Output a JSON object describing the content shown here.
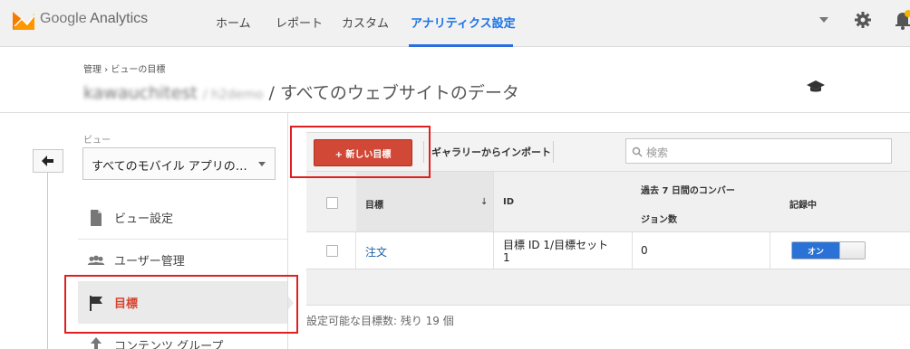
{
  "header": {
    "brand_google": "Google",
    "brand_product": "Analytics",
    "nav": [
      {
        "label": "ホーム",
        "active": false
      },
      {
        "label": "レポート",
        "active": false
      },
      {
        "label": "カスタム",
        "active": false
      },
      {
        "label": "アナリティクス設定",
        "active": true
      }
    ],
    "icons": [
      "analytics-logo-icon",
      "chevron-down-icon",
      "gear-icon",
      "bell-icon"
    ]
  },
  "breadcrumb": {
    "text": "管理 › ビューの目標"
  },
  "page_title": {
    "account_blurred": "kawauchitest",
    "property_blurred": "/ h2demo",
    "view": "/ すべてのウェブサイトのデータ"
  },
  "sidebar": {
    "view_label": "ビュー",
    "view_selected": "すべてのモバイル アプリの…",
    "items": [
      {
        "label": "ビュー設定",
        "icon": "document-icon",
        "active": false
      },
      {
        "label": "ユーザー管理",
        "icon": "users-icon",
        "active": false
      },
      {
        "label": "目標",
        "icon": "flag-icon",
        "active": true
      },
      {
        "label": "コンテンツ グループ",
        "icon": "content-group-icon",
        "active": false
      }
    ]
  },
  "toolbar": {
    "new_goal_label": "+ 新しい目標",
    "gallery_import_label": "ギャラリーからインポート",
    "search_placeholder": "検索"
  },
  "table": {
    "headers": {
      "goal": "目標",
      "id": "ID",
      "conversions_line1": "過去 7 日間のコンバー",
      "conversions_line2": "ジョン数",
      "recording": "記録中"
    },
    "sort_indicator": "↓",
    "rows": [
      {
        "goal": "注文",
        "id_line1": "目標 ID 1/目標セット",
        "id_line2": "1",
        "conversions": "0",
        "recording_label": "オン",
        "recording_on": true
      }
    ]
  },
  "footer": {
    "remaining_text": "設定可能な目標数: 残り 19 個"
  },
  "colors": {
    "accent_blue": "#2a6de0",
    "new_goal_red": "#d14836",
    "annotation_red": "#e02020",
    "toggle_blue": "#2b72d6"
  }
}
